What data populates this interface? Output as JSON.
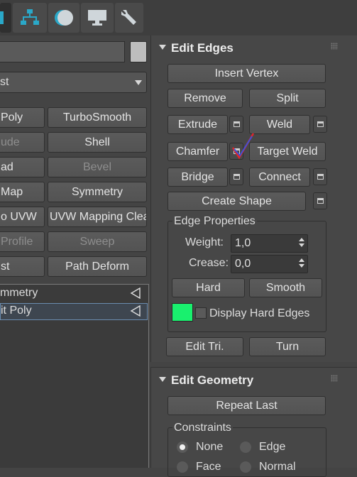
{
  "toolbar": {
    "tabs": [
      "hierarchy-tab",
      "display-tab",
      "motion-tab",
      "utilities-tab"
    ]
  },
  "left_panel": {
    "buttons": [
      {
        "label": "Poly",
        "enabled": true
      },
      {
        "label": "TurboSmooth",
        "enabled": true
      },
      {
        "label": "ude",
        "enabled": false
      },
      {
        "label": "Shell",
        "enabled": true
      },
      {
        "label": "ad",
        "enabled": true
      },
      {
        "label": "Bevel",
        "enabled": false
      },
      {
        "label": "Map",
        "enabled": true
      },
      {
        "label": "Symmetry",
        "enabled": true
      },
      {
        "label": "o UVW",
        "enabled": true
      },
      {
        "label": "UVW Mapping Clear",
        "enabled": true
      },
      {
        "label": "Profile",
        "enabled": false
      },
      {
        "label": "Sweep",
        "enabled": false
      },
      {
        "label": "st",
        "enabled": true
      },
      {
        "label": "Path Deform",
        "enabled": true
      }
    ],
    "dropdown_value": "st",
    "stack": [
      {
        "label": "mmetry"
      },
      {
        "label": "it Poly"
      }
    ]
  },
  "edit_edges": {
    "title": "Edit Edges",
    "insert_vertex": "Insert Vertex",
    "remove": "Remove",
    "split": "Split",
    "extrude": "Extrude",
    "weld": "Weld",
    "chamfer": "Chamfer",
    "target_weld": "Target Weld",
    "bridge": "Bridge",
    "connect": "Connect",
    "create_shape": "Create Shape",
    "edge_properties": {
      "title": "Edge Properties",
      "weight_label": "Weight:",
      "weight_value": "1,0",
      "crease_label": "Crease:",
      "crease_value": "0,0",
      "hard": "Hard",
      "smooth": "Smooth",
      "display_hard_edges": "Display Hard Edges",
      "hard_edge_color": "#19f06e"
    },
    "edit_tri": "Edit Tri.",
    "turn": "Turn"
  },
  "edit_geometry": {
    "title": "Edit Geometry",
    "repeat_last": "Repeat Last",
    "constraints": {
      "title": "Constraints",
      "options": [
        "None",
        "Edge",
        "Face",
        "Normal"
      ],
      "selected": "None"
    }
  },
  "colors": {
    "panel_bg": "#444444",
    "button_bg": "#575757",
    "accent_green": "#19f06e"
  }
}
